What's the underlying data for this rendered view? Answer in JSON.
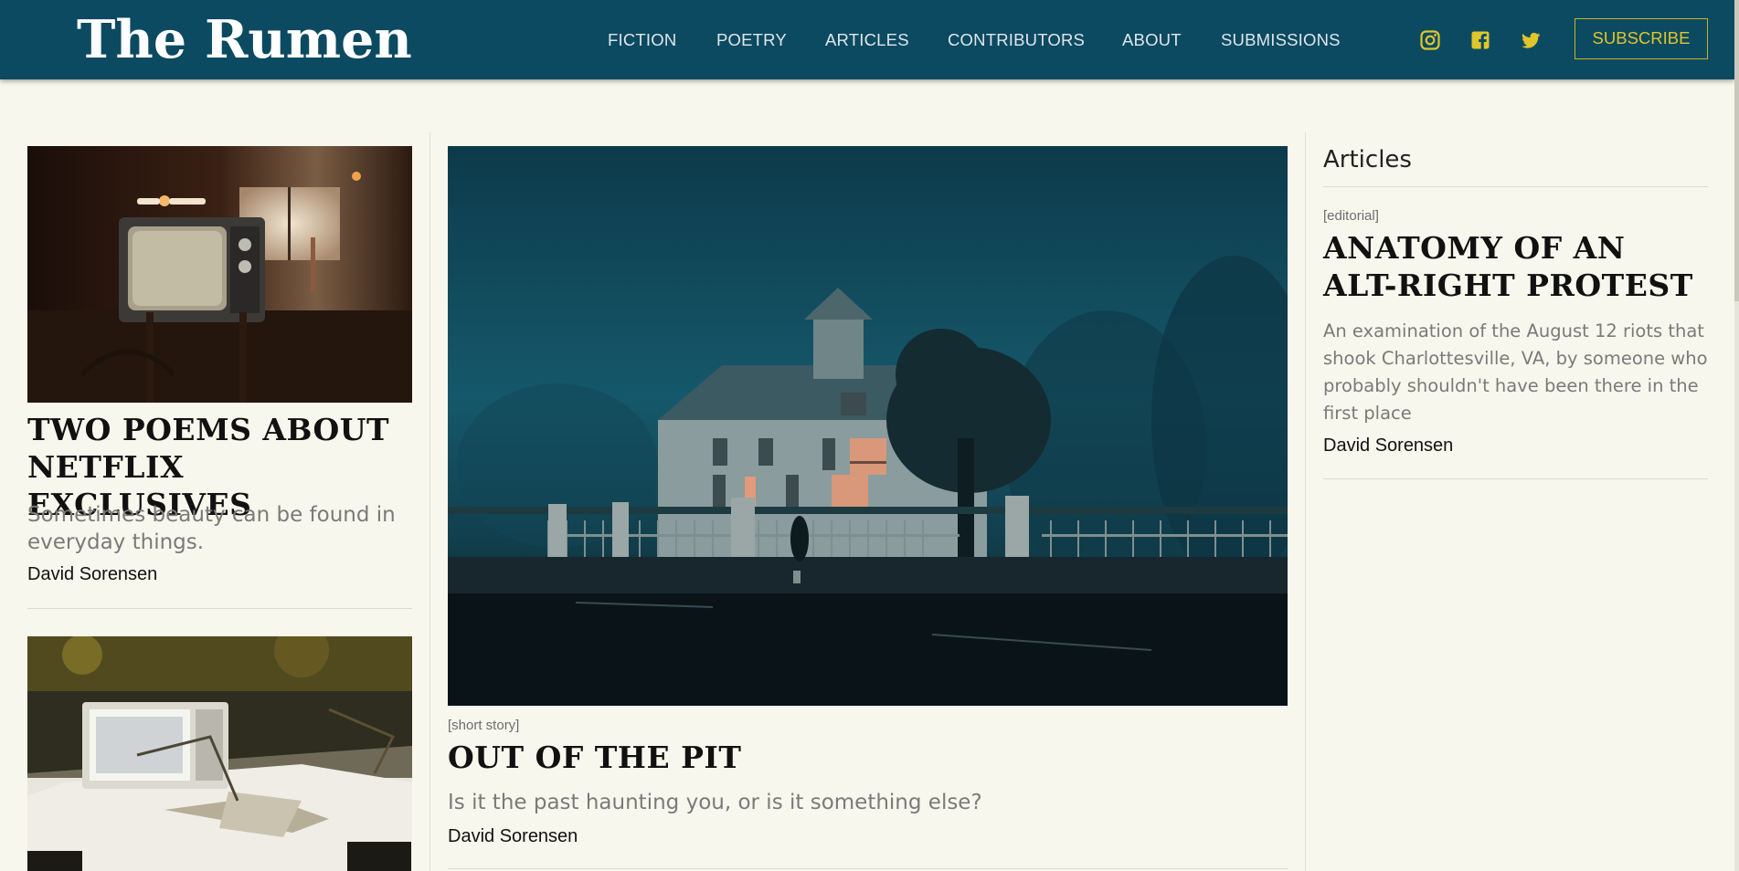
{
  "brand": {
    "name": "The Rumen"
  },
  "nav": {
    "items": [
      {
        "label": "FICTION"
      },
      {
        "label": "POETRY"
      },
      {
        "label": "ARTICLES"
      },
      {
        "label": "CONTRIBUTORS"
      },
      {
        "label": "ABOUT"
      },
      {
        "label": "SUBMISSIONS"
      }
    ],
    "social_icons": [
      "instagram-icon",
      "facebook-icon",
      "twitter-icon"
    ],
    "subscribe_label": "SUBSCRIBE"
  },
  "colors": {
    "header_bg": "#0c4a61",
    "page_bg": "#f8f7ed",
    "accent_gold": "#e0c62a",
    "nav_text": "#dfe6ea"
  },
  "left_column": {
    "cards": [
      {
        "image": "vintage-tv-photo",
        "title": "TWO POEMS ABOUT NETFLIX EXCLUSIVES",
        "description": "Sometimes beauty can be found in everyday things.",
        "author": "David Sorensen"
      },
      {
        "image": "broken-microwave-photo"
      }
    ]
  },
  "featured": {
    "image": "foggy-house-photo",
    "tag": "[short story]",
    "title": "OUT OF THE PIT",
    "description": "Is it the past haunting you, or is it something else?",
    "author": "David Sorensen"
  },
  "aside": {
    "heading": "Articles",
    "items": [
      {
        "tag": "[editorial]",
        "title": "ANATOMY OF AN ALT-RIGHT PROTEST",
        "description": "An examination of the August 12 riots that shook Charlottesville, VA, by someone who probably shouldn't have been there in the first place",
        "author": "David Sorensen"
      }
    ]
  }
}
